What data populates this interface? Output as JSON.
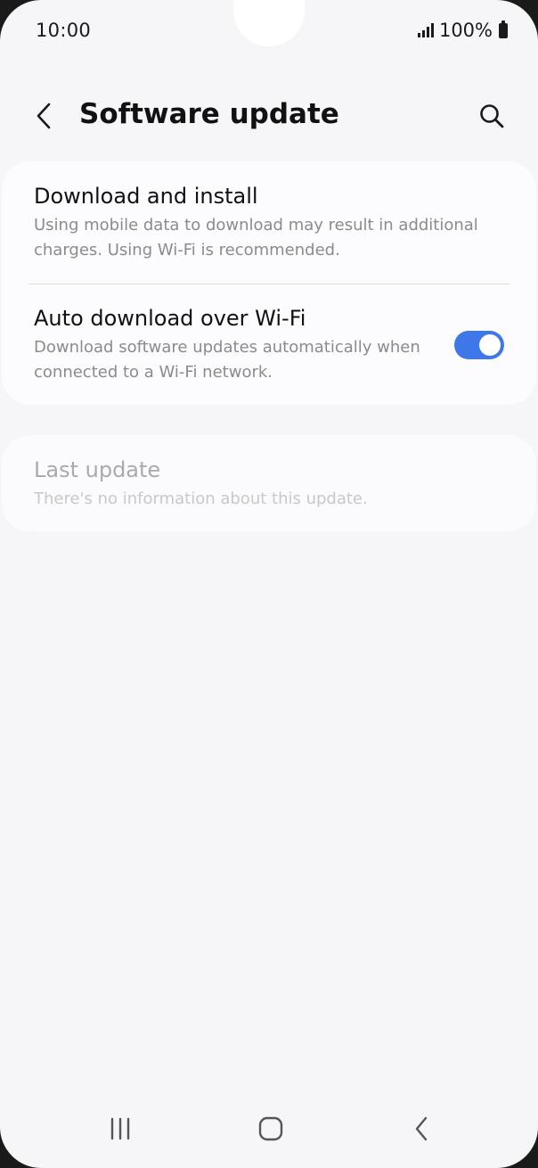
{
  "status_bar": {
    "time": "10:00",
    "battery": "100%"
  },
  "header": {
    "title": "Software update",
    "back_icon": "chevron-left-icon",
    "search_icon": "search-icon"
  },
  "settings": {
    "download_install": {
      "title": "Download and install",
      "description": "Using mobile data to download may result in additional charges. Using Wi-Fi is recommended."
    },
    "auto_download": {
      "title": "Auto download over Wi-Fi",
      "description": "Download software updates automatically when connected to a Wi-Fi network.",
      "enabled": true
    }
  },
  "last_update": {
    "title": "Last update",
    "description": "There's no information about this update."
  },
  "nav_bar": {
    "recents_icon": "recents-icon",
    "home_icon": "home-icon",
    "back_icon": "back-icon"
  },
  "colors": {
    "accent": "#3e77e7",
    "background": "#f6f6f8",
    "card": "#fcfcfe",
    "secondary_text": "#8a8a8f"
  }
}
